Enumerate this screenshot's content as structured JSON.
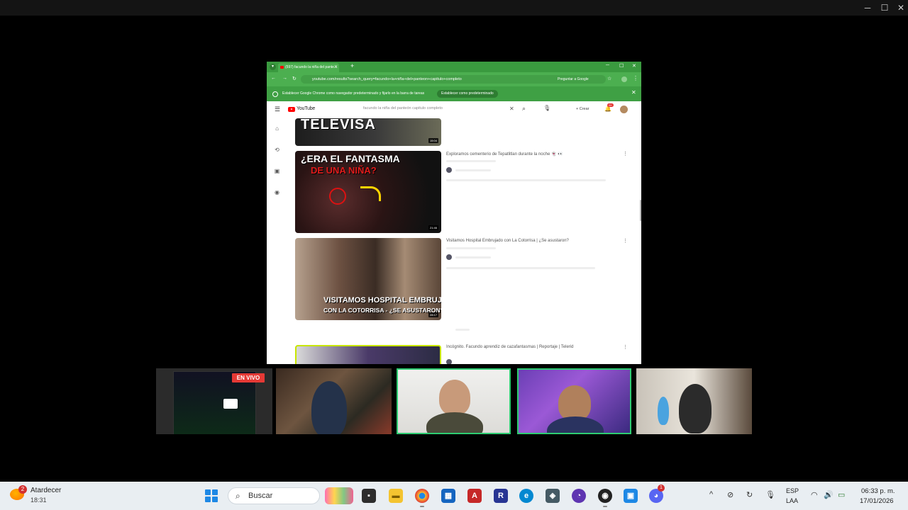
{
  "chrome": {
    "tab_title": "(597) facundo la niña del pante...",
    "url": "youtube.com/results?search_query=facundo+la+niña+del+panteon+capitulo+completo",
    "ask_google": "Preguntar a Google",
    "info_text": "Establecer Google Chrome como navegador predeterminado y fijarlo en la barra de tareas",
    "info_button": "Establecer como predeterminado"
  },
  "youtube": {
    "logo_text": "YouTube",
    "search_query": "facundo la niña del panteón capitulo completo",
    "create_label": "+ Crear",
    "notif_count": "9+",
    "videos": [
      {
        "thumb_text": "TELEVISA",
        "duration": "15:04"
      },
      {
        "title": "Exploramos cementerio de Tepatlitlan durante la noche 👻 👀",
        "thumb_line1": "¿ERA EL FANTASMA",
        "thumb_line2": "DE UNA NIÑA?",
        "duration": "21:46"
      },
      {
        "title": "Visitamos Hospital Embrujado con La Cotorrisa | ¿Se asustaron?",
        "thumb_line1": "VISITAMOS HOSPITAL EMBRUJADO",
        "thumb_line2": "CON LA COTORRISA - ¿SE ASUSTARON?",
        "duration": "28:17"
      },
      {
        "title": "Incógnito. Facundo aprendiz de cazafantasmas | Reportaje | Telerid"
      }
    ]
  },
  "stream": {
    "live_label": "EN VIVO"
  },
  "taskbar": {
    "weather_title": "Atardecer",
    "weather_time": "18:31",
    "weather_badge": "2",
    "search_label": "Buscar",
    "lang_line1": "ESP",
    "lang_line2": "LAA",
    "clock_time": "06:33 p. m.",
    "clock_date": "17/01/2026",
    "discord_badge": "1"
  }
}
